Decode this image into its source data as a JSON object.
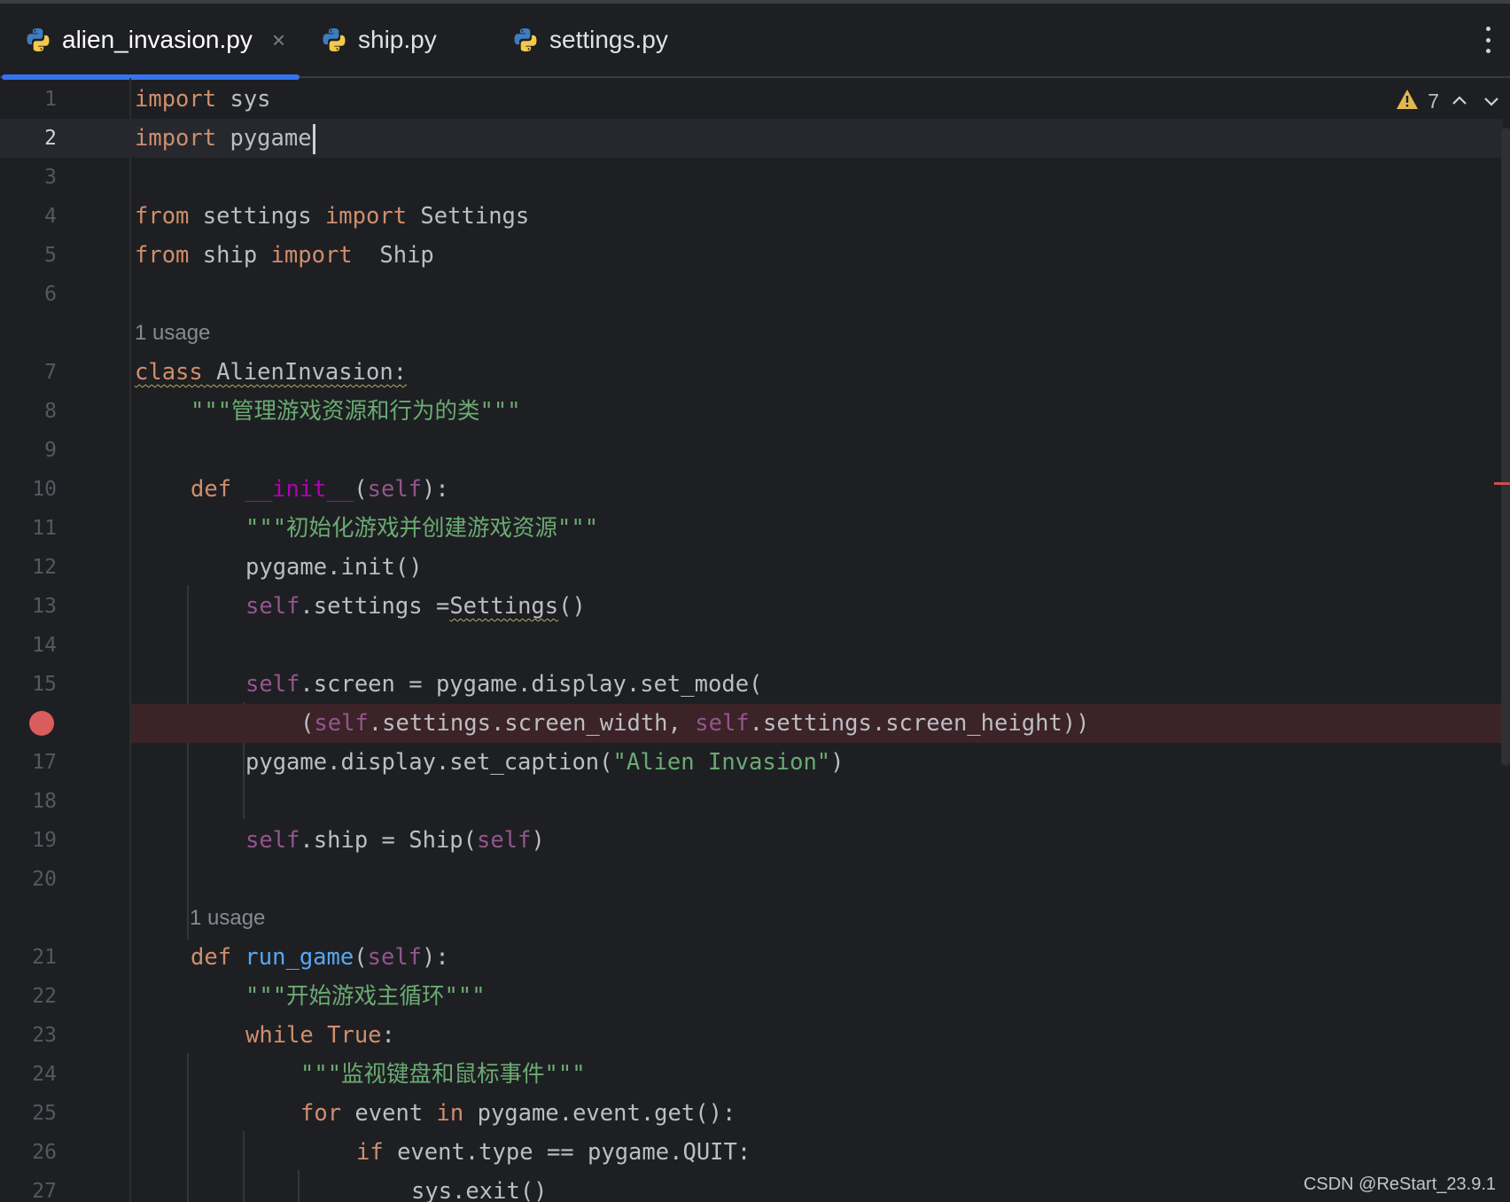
{
  "tabs": [
    {
      "label": "alien_invasion.py",
      "close": "×",
      "icon": "python-icon",
      "active": true
    },
    {
      "label": "ship.py",
      "icon": "python-icon",
      "active": false
    },
    {
      "label": "settings.py",
      "icon": "python-icon",
      "active": false
    }
  ],
  "inspections": {
    "warning_count": "7",
    "icon": "warning-triangle-icon",
    "warning_color": "#e0b84f"
  },
  "editor": {
    "caret_line": 2,
    "breakpoint_line": 16,
    "usage_hints": [
      "1 usage",
      "1 usage"
    ],
    "line_numbers": [
      "1",
      "2",
      "3",
      "4",
      "5",
      "6",
      "7",
      "8",
      "9",
      "10",
      "11",
      "12",
      "13",
      "14",
      "15",
      "17",
      "18",
      "19",
      "20",
      "21",
      "22",
      "23",
      "24",
      "25",
      "26",
      "27"
    ],
    "code": {
      "l1": {
        "kw": "import",
        "rest": " sys"
      },
      "l2": {
        "kw": "import",
        "rest": " pygame"
      },
      "l4": {
        "kw1": "from",
        "mid": " settings ",
        "kw2": "import",
        "rest": " Settings"
      },
      "l5": {
        "kw1": "from",
        "mid": " ship ",
        "kw2": "import",
        "rest": "  Ship"
      },
      "l7": {
        "kw": "class",
        "rest": " AlienInvasion:"
      },
      "l8": {
        "str": "\"\"\"管理游戏资源和行为的类\"\"\""
      },
      "l10": {
        "kw": "def",
        "name": "__init__",
        "p1": "(",
        "self": "self",
        "p2": "):"
      },
      "l11": {
        "str": "\"\"\"初始化游戏并创建游戏资源\"\"\""
      },
      "l12": {
        "text": "pygame.init()"
      },
      "l13": {
        "self": "self",
        "rest": ".settings =",
        "call": "Settings",
        "tail": "()"
      },
      "l15": {
        "self": "self",
        "rest": ".screen = pygame.display.set_mode("
      },
      "l16": {
        "p": "(",
        "self1": "self",
        "mid": ".settings.screen_width, ",
        "self2": "self",
        "rest": ".settings.screen_height))"
      },
      "l17": {
        "pre": "pygame.display.set_caption(",
        "str": "\"Alien Invasion\"",
        "post": ")"
      },
      "l19": {
        "self": "self",
        "mid": ".ship = Ship(",
        "self2": "self",
        "post": ")"
      },
      "l21": {
        "kw": "def",
        "name": "run_game",
        "p1": "(",
        "self": "self",
        "p2": "):"
      },
      "l22": {
        "str": "\"\"\"开始游戏主循环\"\"\""
      },
      "l23": {
        "kw1": "while",
        "sp": " ",
        "kw2": "True",
        "rest": ":"
      },
      "l24": {
        "str": "\"\"\"监视键盘和鼠标事件\"\"\""
      },
      "l25": {
        "kw1": "for",
        "mid": " event ",
        "kw2": "in",
        "rest": " pygame.event.get():"
      },
      "l26": {
        "kw": "if",
        "rest": " event.type == pygame.QUIT:"
      },
      "l27": {
        "text": "sys.exit()"
      }
    }
  },
  "watermark": "CSDN @ReStart_23.9.1",
  "colors": {
    "background": "#1e1f22",
    "keyword": "#cf8e6d",
    "self": "#94558d",
    "string": "#6aab73",
    "function": "#56a8f5",
    "breakpoint": "#db5c5c",
    "tab_underline": "#3574f0"
  }
}
